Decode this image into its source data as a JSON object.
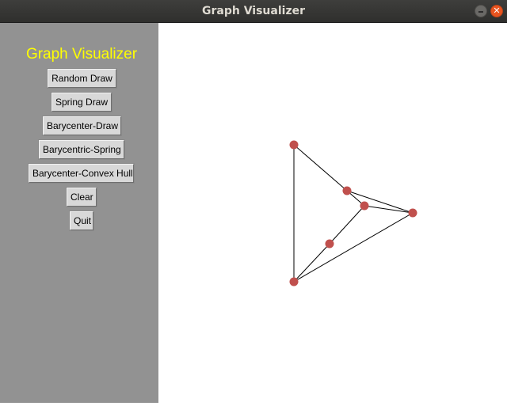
{
  "window": {
    "title": "Graph Visualizer"
  },
  "sidebar": {
    "title": "Graph Visualizer",
    "buttons": [
      "Random Draw",
      "Spring Draw",
      "Barycenter-Draw",
      "Barycentric-Spring",
      "Barycenter-Convex Hull",
      "Clear",
      "Quit"
    ]
  },
  "colors": {
    "sidebar_bg": "#929292",
    "sidebar_title": "#ffff00",
    "node_fill": "#c0504d",
    "edge": "#000000"
  },
  "graph": {
    "nodes": 6,
    "edges": 9
  }
}
